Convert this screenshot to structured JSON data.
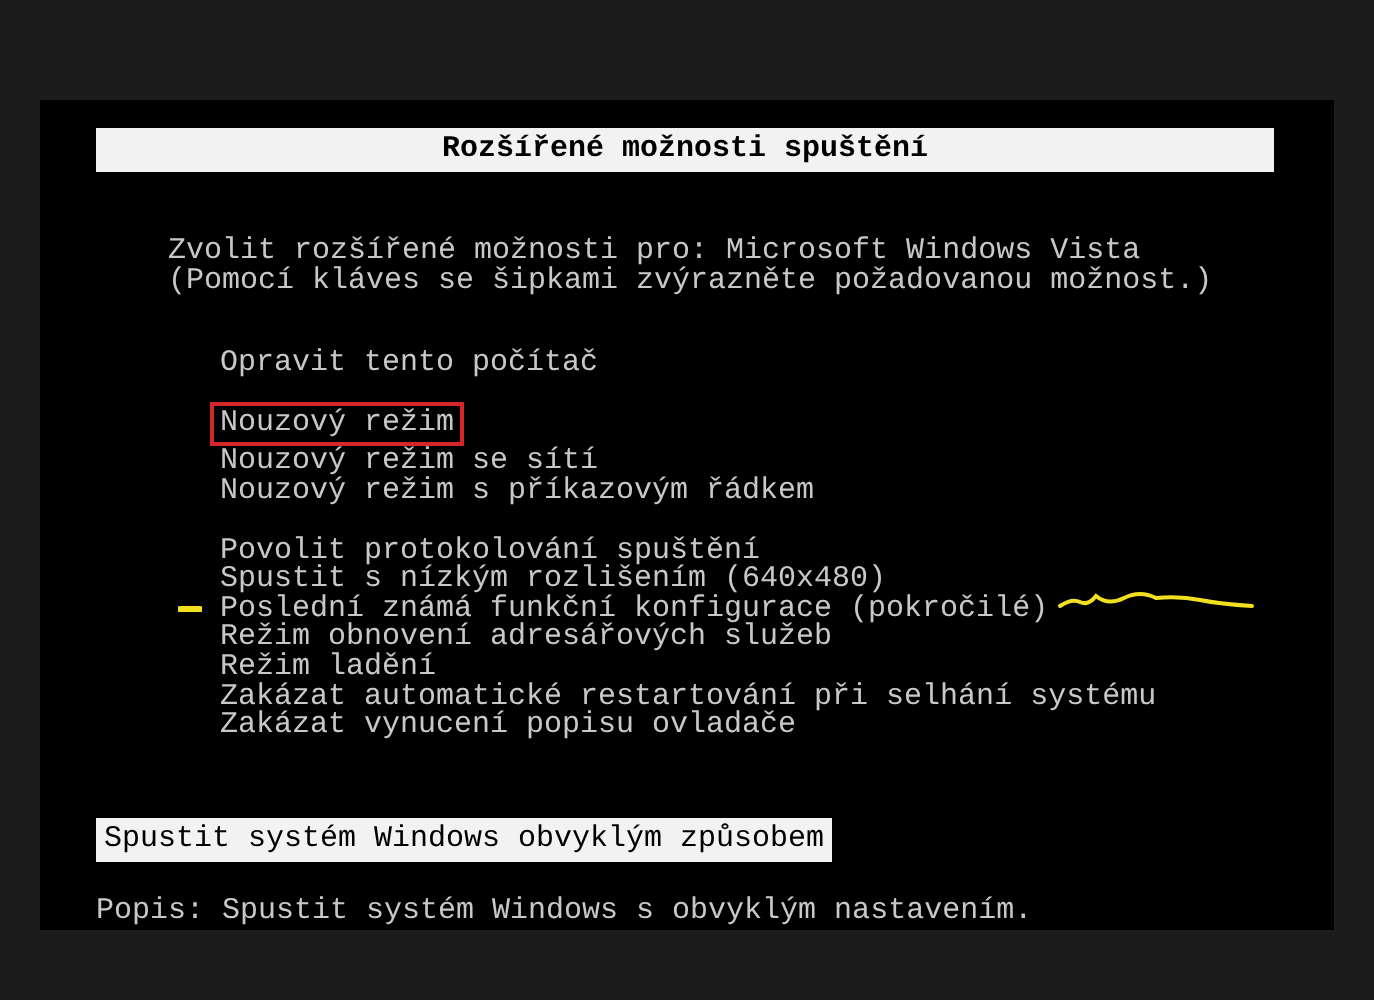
{
  "title": "Rozšířené možnosti spuštění",
  "prompt": [
    "Zvolit rozšířené možnosti pro: Microsoft Windows Vista",
    "(Pomocí kláves se šipkami zvýrazněte požadovanou možnost.)"
  ],
  "option_groups": [
    [
      {
        "label": "Opravit tento počítač",
        "selected": false,
        "boxed": false,
        "scribbled": false
      }
    ],
    [
      {
        "label": "Nouzový režim",
        "selected": false,
        "boxed": true,
        "scribbled": false
      },
      {
        "label": "Nouzový režim se sítí",
        "selected": false,
        "boxed": false,
        "scribbled": false
      },
      {
        "label": "Nouzový režim s příkazovým řádkem",
        "selected": false,
        "boxed": false,
        "scribbled": false
      }
    ],
    [
      {
        "label": "Povolit protokolování spuštění",
        "selected": false,
        "boxed": false,
        "scribbled": false
      },
      {
        "label": "Spustit s nízkým rozlišením (640x480)",
        "selected": false,
        "boxed": false,
        "scribbled": false
      },
      {
        "label": "Poslední známá funkční konfigurace (pokročilé)",
        "selected": false,
        "boxed": false,
        "scribbled": true
      },
      {
        "label": "Režim obnovení adresářových služeb",
        "selected": false,
        "boxed": false,
        "scribbled": false
      },
      {
        "label": "Režim ladění",
        "selected": false,
        "boxed": false,
        "scribbled": false
      },
      {
        "label": "Zakázat automatické restartování při selhání systému",
        "selected": false,
        "boxed": false,
        "scribbled": false
      },
      {
        "label": "Zakázat vynucení popisu ovladače",
        "selected": false,
        "boxed": false,
        "scribbled": false
      }
    ]
  ],
  "default_option": {
    "label": "Spustit systém Windows obvyklým způsobem",
    "selected": true
  },
  "description": "Popis: Spustit systém Windows s obvyklým nastavením."
}
